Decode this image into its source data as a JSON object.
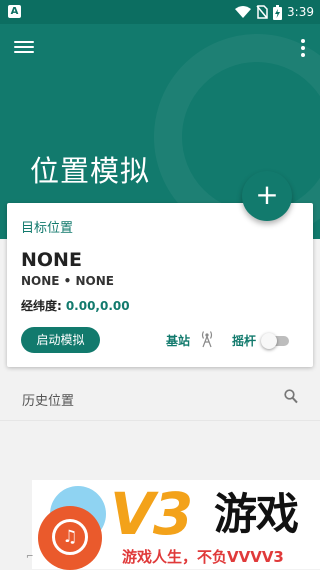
{
  "status_bar": {
    "left_badge": "A",
    "time": "3:39"
  },
  "header": {
    "title": "位置模拟"
  },
  "fab": {
    "label": "+"
  },
  "target_card": {
    "section_label": "目标位置",
    "location_name": "NONE",
    "location_detail": "NONE • NONE",
    "coords_label": "经纬度:",
    "coords_value": "0.00,0.00",
    "start_button": "启动模拟",
    "base_station_label": "基站",
    "joystick_label": "摇杆",
    "joystick_enabled": false
  },
  "history": {
    "label": "历史位置"
  },
  "banner": {
    "brand": "V3",
    "brand_word": "游戏",
    "slogan": "游戏人生，不负VVVV3",
    "logo_glyph": "♫"
  },
  "colors": {
    "primary": "#127a6d",
    "status_bar": "#0c6e61",
    "accent_orange": "#f3a21a",
    "accent_red": "#e03a3a"
  },
  "icons": [
    "menu-icon",
    "more-vert-icon",
    "wifi-icon",
    "no-sim-icon",
    "battery-icon",
    "antenna-icon",
    "search-icon"
  ]
}
